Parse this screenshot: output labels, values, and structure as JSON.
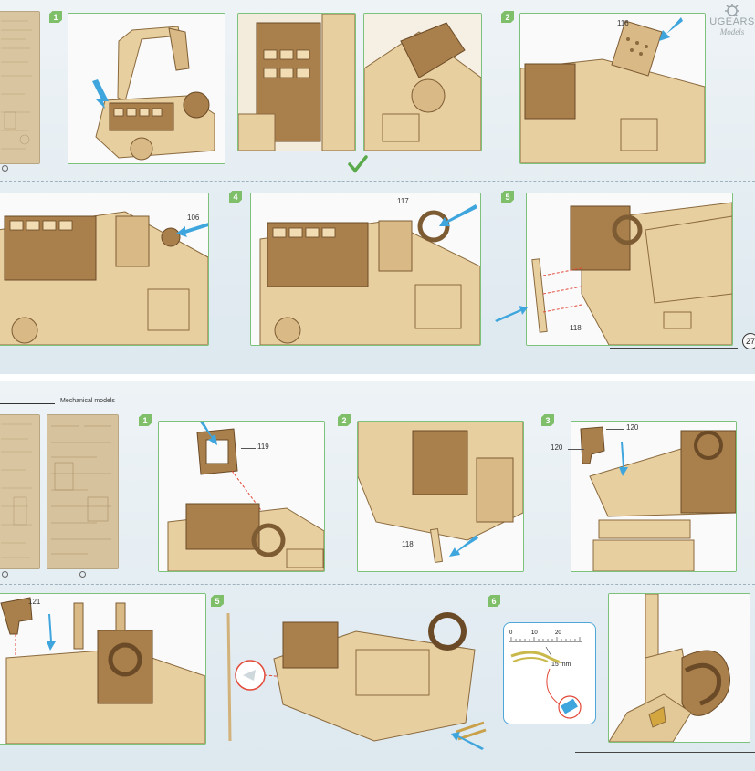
{
  "brand": {
    "name": "UGEARS",
    "tagline": "Models"
  },
  "top_page": {
    "page_number": "27",
    "steps": [
      {
        "number": "1"
      },
      {
        "number": "2",
        "part": "116"
      },
      {
        "number": "4",
        "part_left": "106",
        "part": "117"
      },
      {
        "number": "5",
        "part": "118"
      }
    ],
    "check_icon": "check-icon"
  },
  "bottom_page": {
    "header": "Mechanical models",
    "sheet_markers": [
      "①",
      "①"
    ],
    "steps": [
      {
        "number": "1",
        "part": "119"
      },
      {
        "number": "2",
        "part": "118"
      },
      {
        "number": "3",
        "part_a": "120",
        "part_b": "120"
      },
      {
        "number": "",
        "part": "121"
      },
      {
        "number": "5"
      },
      {
        "number": "6",
        "ruler_ticks": [
          "0",
          "10",
          "20"
        ],
        "length": "15 mm"
      }
    ]
  },
  "colors": {
    "accent_green": "#7fbf6a",
    "arrow_blue": "#3fa5dd",
    "panel_border": "#7cc27a"
  }
}
